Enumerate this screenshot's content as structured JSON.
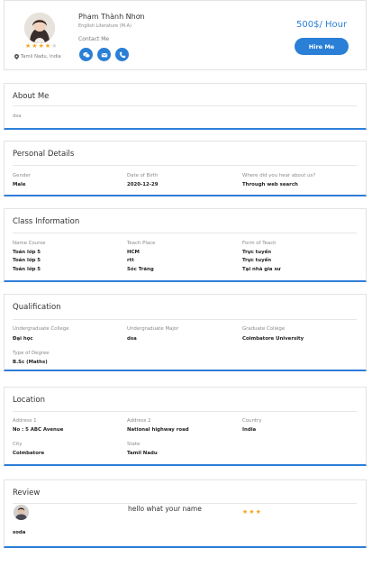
{
  "profile": {
    "name": "Phạm Thành Nhơn",
    "subject": "English Literature (M.A)",
    "contact_label": "Contact Me",
    "location": "Tamil Nadu, India",
    "rating": 4,
    "rating_max": 5,
    "price": "500$/ Hour",
    "hire_label": "Hire Me",
    "contact_icons": [
      "chat-icon",
      "mail-icon",
      "phone-icon"
    ],
    "colors": {
      "accent": "#2a7fd6",
      "star": "#f5a623",
      "star_empty": "#d6d6d6"
    }
  },
  "about": {
    "title": "About Me",
    "text": "dsa"
  },
  "personal": {
    "title": "Personal Details",
    "gender_label": "Gender",
    "gender": "Male",
    "dob_label": "Date of Birth",
    "dob": "2020-12-29",
    "heard_label": "Where did you hear about us?",
    "heard": "Through web search"
  },
  "class_info": {
    "title": "Class Information",
    "headers": [
      "Name Course",
      "Teach Place",
      "Form of Teach"
    ],
    "rows": [
      [
        "Toán lớp 5",
        "HCM",
        "Trực tuyến"
      ],
      [
        "Toán lớp 5",
        "rtt",
        "Trực tuyến"
      ],
      [
        "Toán lớp 5",
        "Sóc Trăng",
        "Tại nhà gia sư"
      ]
    ]
  },
  "qualification": {
    "title": "Qualification",
    "ug_college_label": "Undergraduate College",
    "ug_college": "Đại học",
    "ug_major_label": "Undergraduate Major",
    "ug_major": "dsa",
    "grad_college_label": "Graduate College",
    "grad_college": "Coimbatore University",
    "degree_type_label": "Type of Degree",
    "degree_type": "B.Sc (Maths)"
  },
  "location": {
    "title": "Location",
    "address1_label": "Address 1",
    "address1": "No : 5 ABC Avenue",
    "address2_label": "Address 2",
    "address2": "National highway road",
    "country_label": "Country",
    "country": "India",
    "city_label": "City",
    "city": "Coimbatore",
    "state_label": "State",
    "state": "Tamil Nadu"
  },
  "review": {
    "title": "Review",
    "reviewer": "soda",
    "text": "hello what your name",
    "rating": 3
  }
}
